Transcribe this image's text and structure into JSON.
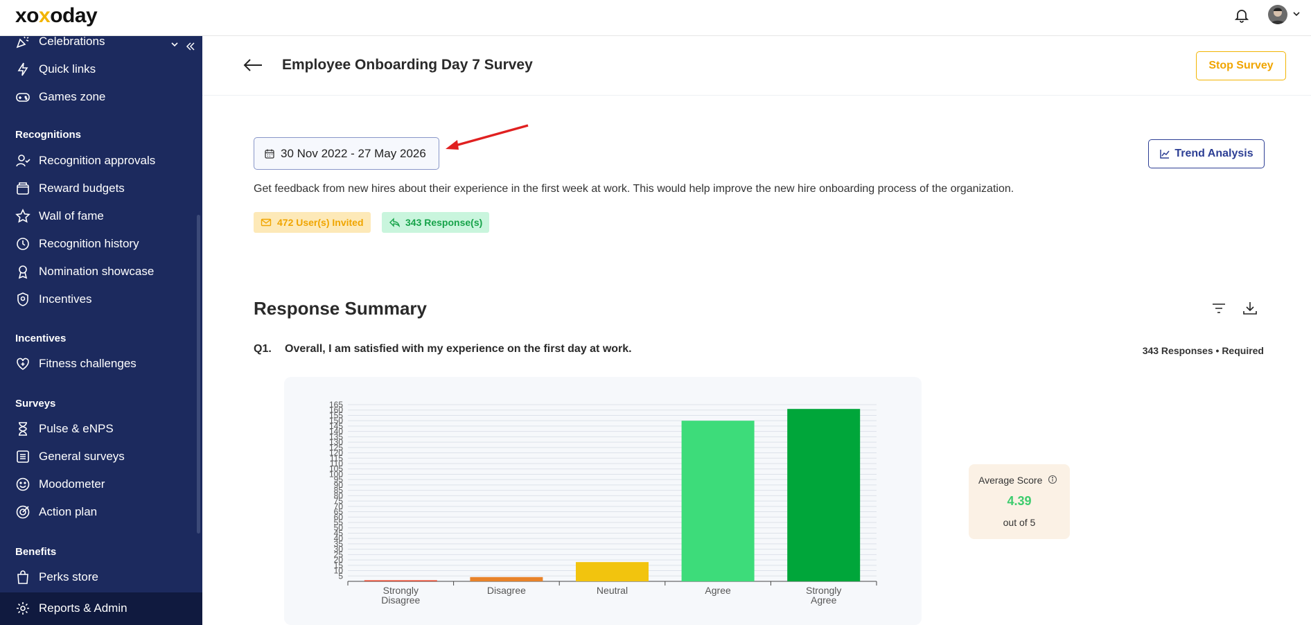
{
  "app": {
    "logo_text_a": "xo",
    "logo_text_b": "x",
    "logo_text_c": "oday"
  },
  "sidebar": {
    "items_top": [
      {
        "label": "Celebrations",
        "icon": "party-icon"
      },
      {
        "label": "Quick links",
        "icon": "bolt-icon"
      },
      {
        "label": "Games zone",
        "icon": "gamepad-icon"
      }
    ],
    "sections": [
      {
        "title": "Recognitions",
        "items": [
          {
            "label": "Recognition approvals",
            "icon": "user-check-icon"
          },
          {
            "label": "Reward budgets",
            "icon": "wallet-icon"
          },
          {
            "label": "Wall of fame",
            "icon": "star-icon"
          },
          {
            "label": "Recognition history",
            "icon": "history-icon"
          },
          {
            "label": "Nomination showcase",
            "icon": "trophy-icon"
          },
          {
            "label": "Incentives",
            "icon": "shield-icon"
          }
        ]
      },
      {
        "title": "Incentives",
        "items": [
          {
            "label": "Fitness challenges",
            "icon": "heart-plus-icon"
          }
        ]
      },
      {
        "title": "Surveys",
        "items": [
          {
            "label": "Pulse & eNPS",
            "icon": "hourglass-icon"
          },
          {
            "label": "General surveys",
            "icon": "list-icon"
          },
          {
            "label": "Moodometer",
            "icon": "smile-icon"
          },
          {
            "label": "Action plan",
            "icon": "target-icon"
          }
        ]
      },
      {
        "title": "Benefits",
        "items": [
          {
            "label": "Perks store",
            "icon": "bag-icon"
          }
        ]
      }
    ],
    "reports": {
      "label": "Reports & Admin",
      "icon": "gear-icon"
    }
  },
  "survey": {
    "title": "Employee Onboarding Day 7 Survey",
    "stop_label": "Stop Survey",
    "date_range": "30 Nov 2022 - 27 May 2026",
    "trend_label": "Trend Analysis",
    "description": "Get feedback from new hires about their experience in the first week at work. This would help improve the new hire onboarding process of the organization.",
    "invited": "472 User(s) Invited",
    "responses": "343 Response(s)"
  },
  "summary": {
    "title": "Response Summary",
    "question_number": "Q1.",
    "question_text": "Overall, I am satisfied with my experience on the first day at work.",
    "question_meta": "343 Responses • Required",
    "average_label": "Average Score",
    "average_value": "4.39",
    "average_sub": "out of 5"
  },
  "colors": {
    "sidebar_bg": "#1c2a5e",
    "accent_yellow": "#f2b400",
    "accent_blue": "#2c3e94",
    "bar_colors": [
      "#e8442a",
      "#e8832a",
      "#f2c40e",
      "#3ddc7a",
      "#00a63a"
    ]
  },
  "chart_data": {
    "type": "bar",
    "categories": [
      [
        "Strongly",
        "Disagree"
      ],
      [
        "Disagree"
      ],
      [
        "Neutral"
      ],
      [
        "Agree"
      ],
      [
        "Strongly",
        "Agree"
      ]
    ],
    "values": [
      1,
      4,
      18,
      150,
      161
    ],
    "ylim": [
      0,
      165
    ],
    "yticks": [
      5,
      10,
      15,
      20,
      25,
      30,
      35,
      40,
      45,
      50,
      55,
      60,
      65,
      70,
      75,
      80,
      85,
      90,
      95,
      100,
      105,
      110,
      115,
      120,
      125,
      130,
      135,
      140,
      145,
      150,
      155,
      160,
      165
    ],
    "grid": true
  }
}
